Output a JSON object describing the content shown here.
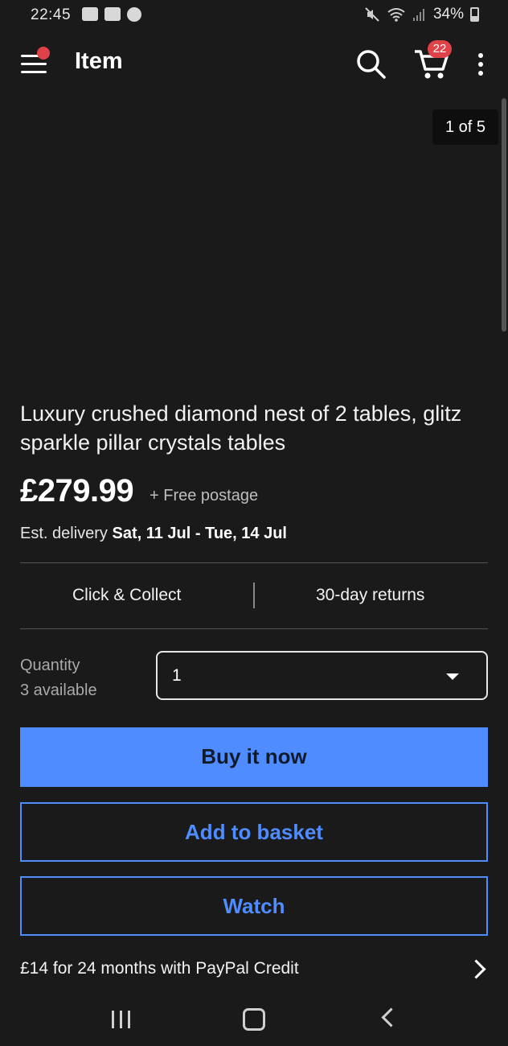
{
  "status_bar": {
    "time": "22:45",
    "battery": "34%",
    "icons_left": [
      "gallery-icon",
      "youtube-icon",
      "badge-icon"
    ],
    "icons_right": [
      "mute-icon",
      "wifi-icon",
      "signal-icon",
      "battery-icon"
    ]
  },
  "app_bar": {
    "title": "Item",
    "cart_count": "22"
  },
  "gallery": {
    "counter": "1 of 5"
  },
  "listing": {
    "title": "Luxury crushed diamond nest of 2 tables, glitz sparkle pillar crystals tables",
    "price": "£279.99",
    "postage": "+ Free postage",
    "delivery_prefix": "Est. delivery ",
    "delivery_dates": "Sat, 11 Jul - Tue, 14 Jul"
  },
  "features": {
    "collect": "Click & Collect",
    "returns": "30-day returns"
  },
  "quantity": {
    "label": "Quantity",
    "available": "3 available",
    "selected": "1"
  },
  "buttons": {
    "buy_now": "Buy it now",
    "add_to_basket": "Add to basket",
    "watch": "Watch"
  },
  "paypal": {
    "text": "£14 for 24 months with PayPal Credit"
  },
  "colors": {
    "background": "#1a1a1b",
    "accent": "#4e8cff",
    "badge": "#e0424a"
  }
}
